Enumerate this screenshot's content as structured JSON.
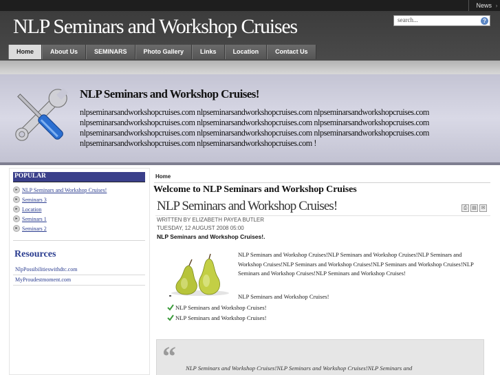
{
  "topbar": {
    "news_label": "News",
    "arrow": "›"
  },
  "header": {
    "site_title": "NLP Seminars and Workshop Cruises",
    "search_placeholder": "search...",
    "search_icon": "?"
  },
  "nav": {
    "items": [
      {
        "label": "Home",
        "active": true
      },
      {
        "label": "About Us"
      },
      {
        "label": "SEMINARS"
      },
      {
        "label": "Photo Gallery"
      },
      {
        "label": "Links"
      },
      {
        "label": "Location"
      },
      {
        "label": "Contact Us"
      }
    ]
  },
  "banner": {
    "title": "NLP Seminars and Workshop Cruises!",
    "text": "nlpseminarsandworkshopcruises.com nlpseminarsandworkshopcruises.com nlpseminarsandworkshopcruises.com nlpseminarsandworkshopcruises.com nlpseminarsandworkshopcruises.com nlpseminarsandworkshopcruises.com nlpseminarsandworkshopcruises.com nlpseminarsandworkshopcruises.com nlpseminarsandworkshopcruises.com nlpseminarsandworkshopcruises.com nlpseminarsandworkshopcruises.com !"
  },
  "sidebar": {
    "popular_heading": "POPULAR",
    "popular_bullet": "▸",
    "popular": [
      "NLP Seminars and Workshop Cruises!",
      "Seminars 3",
      "Location",
      "Seminars 1",
      "Seminars 2"
    ],
    "resources_heading": "Resources",
    "resources": [
      "NlpPossibilitieswithdtc.com",
      "MyProudestmoment.com"
    ]
  },
  "main": {
    "breadcrumb": "Home",
    "page_heading": "Welcome to NLP Seminars and Workshop Cruises",
    "article_title": "NLP Seminars and Workshop Cruises!",
    "icons": {
      "pdf": "⎙",
      "print": "▤",
      "email": "✉"
    },
    "author": "WRITTEN BY ELIZABETH PAYEA BUTLER",
    "date": "TUESDAY, 12 AUGUST 2008 05:00",
    "lead": "NLP Seminars and Workshop Cruises!.",
    "body": "NLP Seminars and Workshop Cruises!NLP Seminars and Workshop Cruises!NLP Seminars and Workshop Cruises!NLP Seminars and Workshop Cruises!NLP Seminars and Workshop Cruises!NLP Seminars and Workshop Cruises!NLP Seminars and Workshop Cruises!",
    "para2": "NLP Seminars and Workshop Cruises!",
    "checklist": [
      "NLP Seminars and Workshop Cruises!",
      "NLP Seminars and Workshop Cruises!"
    ],
    "quote_mark": "“",
    "quote": "NLP Seminars and Workshop Cruises!NLP Seminars and Workshop Cruises!NLP Seminars and"
  },
  "colors": {
    "header_bg": "#444444",
    "accent_blue": "#3a3f8a",
    "link": "#2a3c8f"
  }
}
